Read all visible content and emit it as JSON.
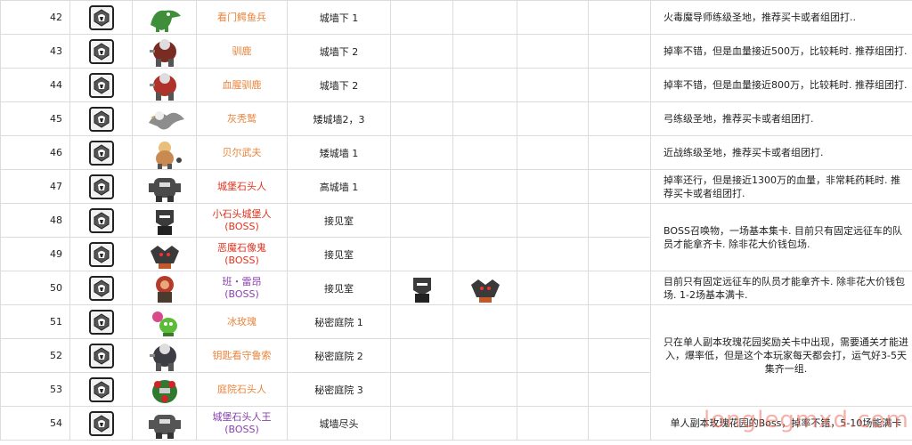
{
  "rows": [
    {
      "num": "42",
      "name": "看门鳄鱼兵",
      "name2": "",
      "color": "orange",
      "location": "城墙下 1",
      "note": "火毒魔导师练级圣地，推荐买卡或者组团打..",
      "monster": "croc",
      "mcolor": "#3f8f3a"
    },
    {
      "num": "43",
      "name": "驯鹿",
      "name2": "",
      "color": "orange",
      "location": "城墙下 2",
      "note": "掉率不错，但是血量接近500万，比较耗时. 推荐组团打.",
      "monster": "brute",
      "mcolor": "#7a2b22"
    },
    {
      "num": "44",
      "name": "血腥驯鹿",
      "name2": "",
      "color": "orange",
      "location": "城墙下 2",
      "note": "掉率不错，但是血量接近800万，比较耗时. 推荐组团打.",
      "monster": "brute",
      "mcolor": "#b0302a"
    },
    {
      "num": "45",
      "name": "灰秃鹫",
      "name2": "",
      "color": "orange",
      "location": "矮城墙2，3",
      "note": "弓练级圣地，推荐买卡或者组团打.",
      "monster": "bird",
      "mcolor": "#8d8d8d"
    },
    {
      "num": "46",
      "name": "贝尔武夫",
      "name2": "",
      "color": "orange",
      "location": "矮城墙 1",
      "note": "近战练级圣地，推荐买卡或者组团打.",
      "monster": "beast",
      "mcolor": "#c98a52"
    },
    {
      "num": "47",
      "name": "城堡石头人",
      "name2": "",
      "color": "red",
      "location": "高城墙 1",
      "note": "掉率还行，但是接近1300万的血量，非常耗药耗时. 推荐买卡或者组团打.",
      "monster": "golem",
      "mcolor": "#4a4a4a"
    },
    {
      "num": "48",
      "name": "小石头城堡人",
      "name2": "(BOSS)",
      "color": "red",
      "location": "接见室",
      "monster": "knight",
      "mcolor": "#3b3b3b"
    },
    {
      "num": "49",
      "name": "恶魔石像鬼",
      "name2": "(BOSS)",
      "color": "red",
      "location": "接见室",
      "monster": "gargoyle",
      "mcolor": "#3a3a3a"
    },
    {
      "num": "50",
      "name": "班・雷昂",
      "name2": "(BOSS)",
      "color": "purple",
      "location": "接见室",
      "note": "目前只有固定远征车的队员才能拿齐卡. 除非花大价钱包场. 1-2场基本满卡.",
      "monster": "lion",
      "mcolor": "#b53a2a"
    },
    {
      "num": "51",
      "name": "冰玫瑰",
      "name2": "",
      "color": "orange",
      "location": "秘密庭院 1",
      "monster": "rose",
      "mcolor": "#5dbb3a"
    },
    {
      "num": "52",
      "name": "钥匙看守鲁索",
      "name2": "",
      "color": "orange",
      "location": "秘密庭院 2",
      "monster": "brute",
      "mcolor": "#3d3d46"
    },
    {
      "num": "53",
      "name": "庭院石头人",
      "name2": "",
      "color": "orange",
      "location": "秘密庭院 3",
      "monster": "rosegolem",
      "mcolor": "#2e7a2e"
    },
    {
      "num": "54",
      "name": "城堡石头人王",
      "name2": "(BOSS)",
      "color": "purple",
      "location": "城墙尽头",
      "note": "单人副本玫瑰花园的Boss，掉率不错，5-10场能满卡",
      "monster": "golem",
      "mcolor": "#555555"
    }
  ],
  "merged_notes": {
    "boss_48_49": "BOSS召唤物，一场基本集卡. 目前只有固定远征车的队员才能拿齐卡. 除非花大价钱包场.",
    "rose_51_53": "只在单人副本玫瑰花园奖励关卡中出现，需要通关才能进入，爆率低，但是这个本玩家每天都会打，运气好3-5天集齐一组."
  },
  "watermark": "longlegmxd.com"
}
